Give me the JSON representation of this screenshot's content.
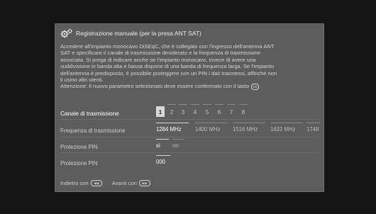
{
  "dialog": {
    "title": "Registrazione manuale (per la presa ANT SAT)",
    "title_icon": "gear-icon",
    "info_lines": [
      "Accedere all'impianto monocavo DiSEqC, che è collegato con l'ingresso dell'antenna ANT",
      "SAT e specificare il canale di trasmissione desiderato e la frequenza di trasmissione",
      "associata. Si prega di indicare anche se l'impianto monocavo, invece di avere una",
      "suddivisione in banda alta e bassa dispone di una banda di frequenza larga. Se l'impianto",
      "dell'antenna è predisposto, è possibile proteggere con un PIN i dati trasmessi, affinché non",
      "li usino altri utenti."
    ],
    "attention_text": "Attenzione: Il nuovo parametro selezionato deve essere confermato con il tasto",
    "ok_icon_label": "OK"
  },
  "fields": {
    "channel": {
      "label": "Canale di trasmissione",
      "options": [
        "1",
        "2",
        "3",
        "4",
        "5",
        "6",
        "7",
        "8"
      ],
      "selected_index": 0
    },
    "frequency": {
      "label": "Frequenza di trasmissione",
      "options": [
        "1284 MHz",
        "1400 MHz",
        "1516 MHz",
        "1632 MHz",
        "1748"
      ],
      "selected_index": 0
    },
    "pin_protection": {
      "label": "Protezione PIN",
      "options": [
        "sì",
        "no"
      ],
      "selected_index": 0
    },
    "pin": {
      "label": "Protezione PIN",
      "value": "000"
    }
  },
  "footer": {
    "back_label": "Indietro con",
    "back_icon": "back-button-icon",
    "forward_label": "Avanti con",
    "forward_icon": "forward-button-icon"
  },
  "colors": {
    "background": "#141414",
    "panel": "#5d5d5d",
    "selected_highlight": "#d8d8d8"
  }
}
